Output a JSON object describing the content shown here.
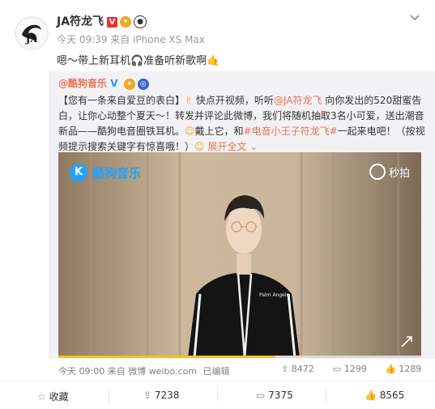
{
  "user": {
    "name": "JA符龙飞",
    "verified_mark": "V"
  },
  "meta": {
    "time": "今天 09:39",
    "source_prefix": "来自",
    "source": "iPhone XS Max"
  },
  "post": {
    "text": "嗯～带上新耳机🎧准备听新歌啊🤙"
  },
  "repost": {
    "user": "@酷狗音乐",
    "text_l1_a": "【您有一条来自爱豆的表白】",
    "text_l1_b": "快点开视频，听听",
    "mention": "@JA符龙飞",
    "text_l1_c": "向你发出的520甜蜜告",
    "text_l2": "白，让你心动整个夏天～！转发并评论此微博，我们将随机抽取3名小可爱，送出潮音",
    "text_l3_a": "新品——酷狗电音圈铁耳机。",
    "text_l3_b": "戴上它，和",
    "hashtag": "#电音小王子符龙飞#",
    "text_l3_c": "一起来电吧！（按视",
    "text_l4": "频提示搜索关键字有惊喜哦！）",
    "expand": "展开全文",
    "video": {
      "brand": "酷狗音乐",
      "watermark": "秒拍",
      "shirt_text": "Palm Angels"
    },
    "footer": {
      "time": "今天 09:00",
      "source_prefix": "来自",
      "source": "微博 weibo.com",
      "edited": "已编辑"
    },
    "stats": {
      "reposts": "8472",
      "comments": "1299",
      "likes": "1289"
    }
  },
  "actions": {
    "favorite": "收藏",
    "repost": "7238",
    "comment": "7375",
    "like": "8565"
  },
  "colors": {
    "accent": "#eb7350",
    "link": "#eb7350",
    "verified": "#e8302d"
  }
}
